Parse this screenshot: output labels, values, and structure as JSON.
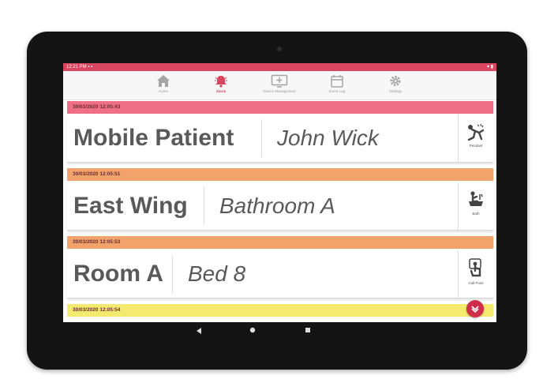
{
  "statusbar": {
    "left": "12:21 PM  ▪  ▪",
    "right": "▾ ▮"
  },
  "nav": {
    "items": [
      {
        "label": "Home",
        "icon": "home-icon",
        "active": false
      },
      {
        "label": "Alarm",
        "icon": "bell-icon",
        "active": true
      },
      {
        "label": "Device Management",
        "icon": "monitor-plus-icon",
        "active": false
      },
      {
        "label": "Event Log",
        "icon": "calendar-icon",
        "active": false
      },
      {
        "label": "Settings",
        "icon": "gear-icon",
        "active": false
      }
    ]
  },
  "alerts": [
    {
      "timestamp": "30/03/2020 12:05:43",
      "location": "Mobile Patient",
      "detail": "John Wick",
      "type_label": "Pendant",
      "type_icon": "pendant-fall-icon",
      "color": "#ef6f86"
    },
    {
      "timestamp": "30/03/2020 12:05:51",
      "location": "East Wing",
      "detail": "Bathroom A",
      "type_label": "Bath",
      "type_icon": "bath-icon",
      "color": "#f2a36b"
    },
    {
      "timestamp": "30/03/2020 12:05:53",
      "location": "Room A",
      "detail": "Bed 8",
      "type_label": "Call Point",
      "type_icon": "call-point-icon",
      "color": "#f2a36b"
    },
    {
      "timestamp": "30/03/2020 12:05:54",
      "color": "#f4ea70"
    }
  ],
  "colors": {
    "accent": "#d8455e",
    "bezel": "#141414"
  }
}
